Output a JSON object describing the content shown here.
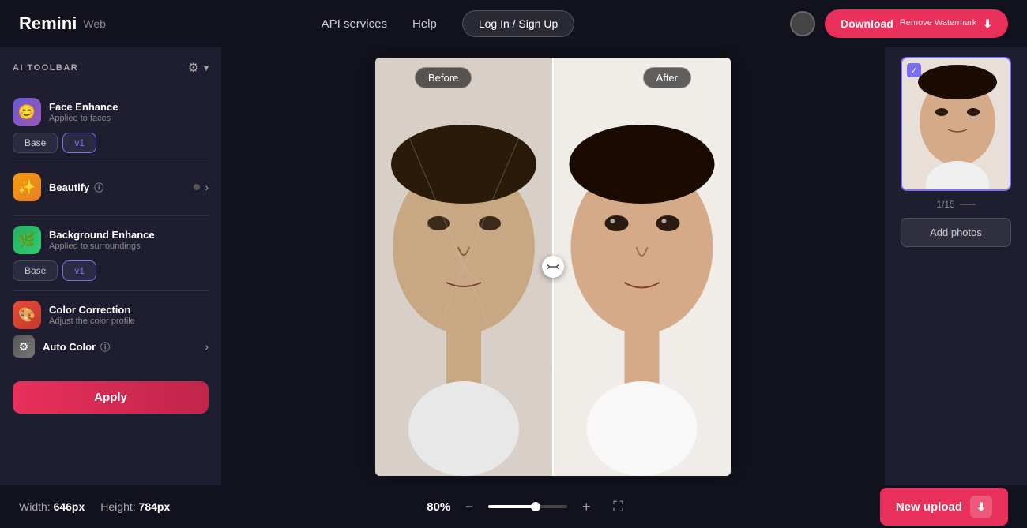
{
  "header": {
    "logo_remini": "Remini",
    "logo_web": "Web",
    "nav": {
      "api": "API services",
      "help": "Help",
      "login": "Log In / Sign Up",
      "download": "Download",
      "download_sub": "Remove Watermark",
      "download_icon": "⬇"
    }
  },
  "sidebar": {
    "label": "AI TOOLBAR",
    "tools": [
      {
        "name": "Face Enhance",
        "sub": "Applied to faces",
        "icon": "😊",
        "icon_class": "tool-icon-face",
        "versions": [
          "Base",
          "v1"
        ],
        "active_version": "v1"
      },
      {
        "name": "Beautify",
        "sub": "",
        "icon": "✨",
        "icon_class": "tool-icon-beautify",
        "has_arrow": true,
        "has_info": true,
        "has_dot": true
      },
      {
        "name": "Background Enhance",
        "sub": "Applied to surroundings",
        "icon": "🌿",
        "icon_class": "tool-icon-bg",
        "versions": [
          "Base",
          "v1"
        ],
        "active_version": "v1"
      },
      {
        "name": "Color Correction",
        "sub": "Adjust the color profile",
        "icon": "🎨",
        "icon_class": "tool-icon-color"
      },
      {
        "name": "Auto Color",
        "sub": "",
        "icon": "⚙",
        "icon_class": "tool-icon-autocolor",
        "has_arrow": true,
        "has_info": true
      }
    ],
    "apply_btn": "Apply"
  },
  "canvas": {
    "label_before": "Before",
    "label_after": "After"
  },
  "bottom_bar": {
    "width_label": "Width:",
    "width_value": "646px",
    "height_label": "Height:",
    "height_value": "784px",
    "zoom_percent": "80%",
    "zoom_minus": "−",
    "zoom_plus": "+"
  },
  "right_panel": {
    "pagination": "1/15",
    "add_photos": "Add photos"
  },
  "new_upload": {
    "label": "New upload",
    "icon": "⬇"
  }
}
